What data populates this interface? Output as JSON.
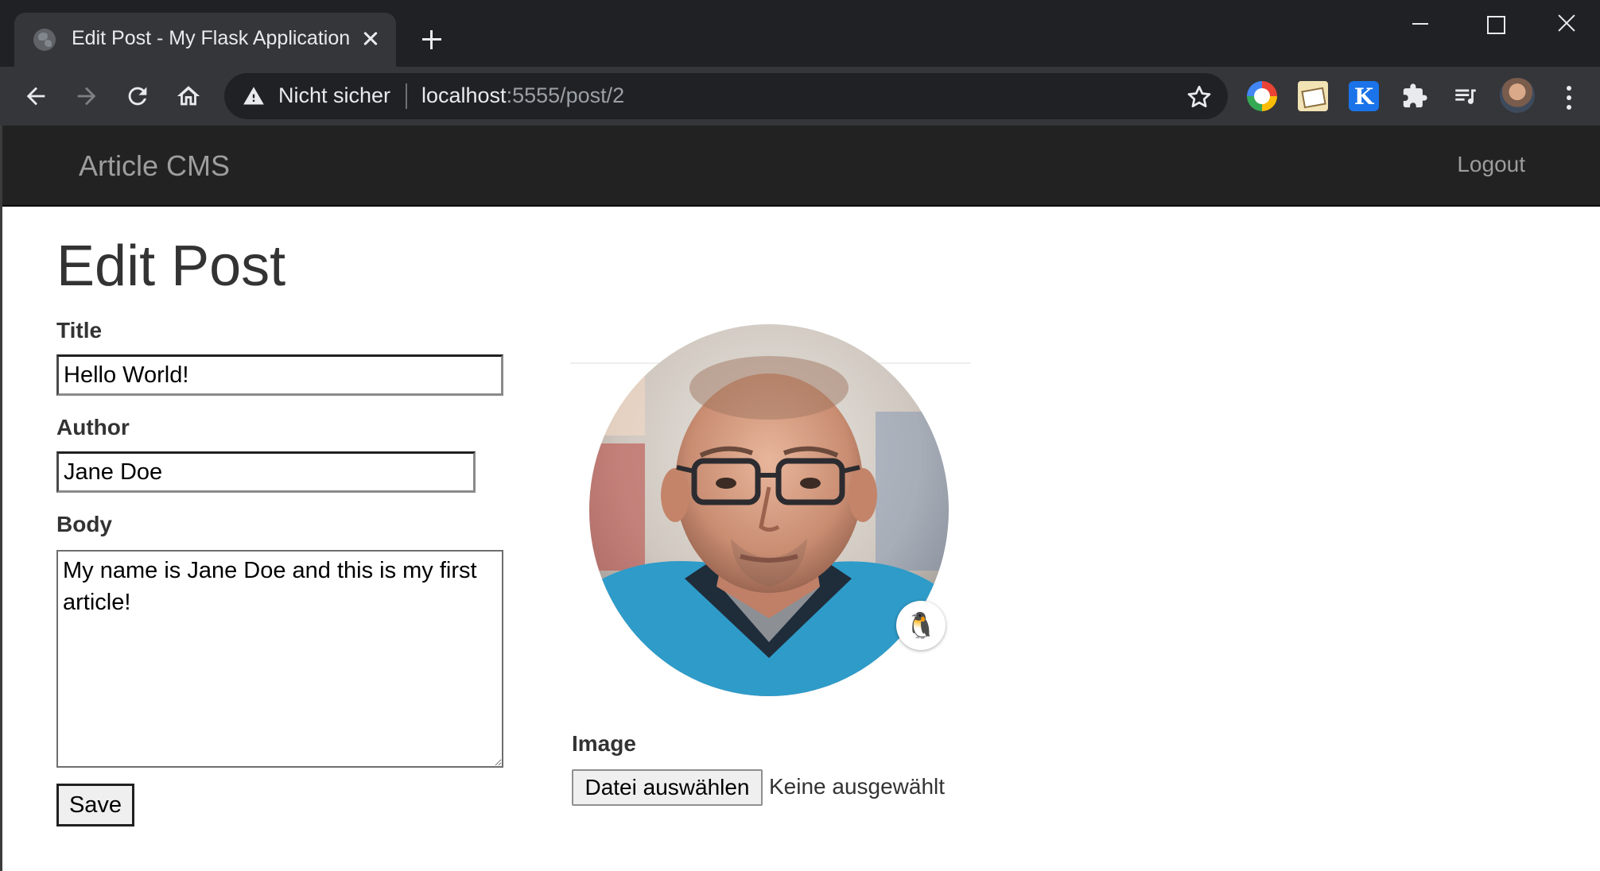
{
  "browser": {
    "tab_title": "Edit Post - My Flask Application",
    "security_label": "Nicht sicher",
    "url_host": "localhost",
    "url_path": ":5555/post/2",
    "extension_k_label": "K"
  },
  "navbar": {
    "brand": "Article CMS",
    "logout": "Logout"
  },
  "form": {
    "heading": "Edit Post",
    "title_label": "Title",
    "title_value": "Hello World!",
    "author_label": "Author",
    "author_value": "Jane Doe",
    "body_label": "Body",
    "body_value": "My name is Jane Doe and this is my first article!",
    "save_label": "Save",
    "image_label": "Image",
    "file_button_label": "Datei auswählen",
    "file_status": "Keine ausgewählt",
    "edit_badge_icon": "penguin-icon"
  },
  "colors": {
    "chrome_dark": "#202124",
    "chrome_toolbar": "#35363a",
    "navbar_bg": "#222222",
    "navbar_text": "#9d9d9d",
    "page_text": "#333333"
  }
}
